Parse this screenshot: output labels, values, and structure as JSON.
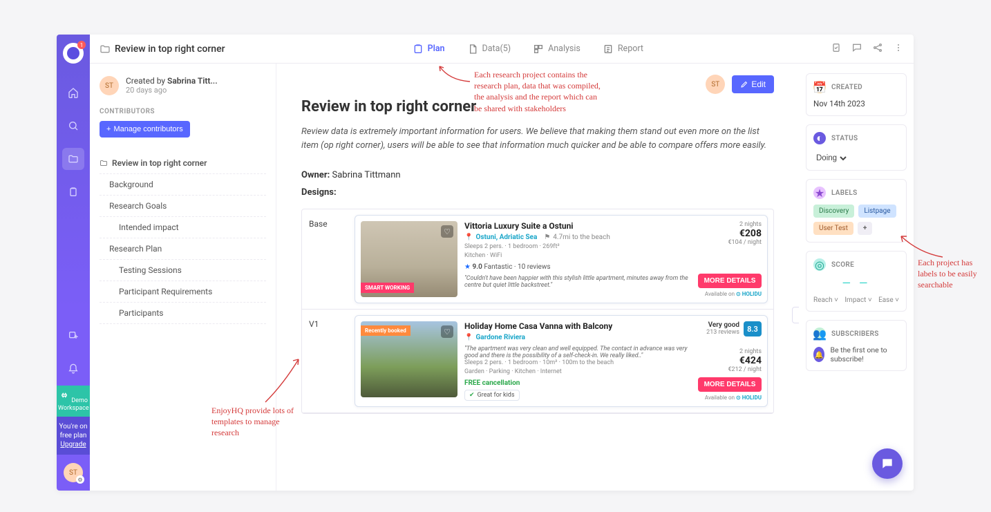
{
  "rail": {
    "logo_badge": "1",
    "demo_line1": "Demo",
    "demo_line2": "Workspace",
    "upgrade_line1": "You're on",
    "upgrade_line2": "free plan",
    "upgrade_link": "Upgrade",
    "avatar_initials": "ST"
  },
  "topbar": {
    "title": "Review in top right corner",
    "tabs": {
      "plan": "Plan",
      "data": "Data(5)",
      "analysis": "Analysis",
      "report": "Report"
    }
  },
  "meta": {
    "created_by_prefix": "Created by ",
    "created_by_name": "Sabrina Titt...",
    "created_ago": "20 days ago",
    "creator_initials": "ST",
    "contributors_head": "CONTRIBUTORS",
    "manage_btn": "Manage contributors"
  },
  "outline": {
    "root": "Review in top right corner",
    "items": [
      {
        "label": "Background",
        "lvl": 1
      },
      {
        "label": "Research Goals",
        "lvl": 1
      },
      {
        "label": "Intended impact",
        "lvl": 2
      },
      {
        "label": "Research Plan",
        "lvl": 1
      },
      {
        "label": "Testing Sessions",
        "lvl": 2
      },
      {
        "label": "Participant Requirements",
        "lvl": 2
      },
      {
        "label": "Participants",
        "lvl": 2
      }
    ]
  },
  "content": {
    "owner_initials": "ST",
    "edit_label": "Edit",
    "h1": "Review in top right corner",
    "intro": "Review data is extremely important information for users. We believe that making them stand out even more on the list item (op right corner), users will be able to see that information much quicker and be able to compare offers more easily.",
    "owner_label": "Owner:",
    "owner_value": "Sabrina Tittmann",
    "designs_label": "Designs:",
    "rows": [
      {
        "variant": "Base",
        "listing": {
          "img_tag": "SMART WORKING",
          "title": "Vittoria Luxury Suite a Ostuni",
          "loc1": "Ostuni, Adriatic Sea",
          "loc2": "4.7mi to the beach",
          "specs1": "Sleeps 2 pers. · 1 bedroom · 269ft²",
          "specs2": "Kitchen · WiFi",
          "rating_score": "9.0",
          "rating_label": "Fantastic · 10 reviews",
          "quote": "\"Couldn't have been happier with this stylish little apartment, minutes away from the centre but quiet little backstreet.\"",
          "nights": "2 nights",
          "price": "€208",
          "per_night": "€104 / night",
          "more": "MORE DETAILS",
          "avail": "Available on",
          "avail_brand": "HOLIDU"
        }
      },
      {
        "variant": "V1",
        "listing": {
          "img_tag": "Recently booked",
          "title": "Holiday Home Casa Vanna with Balcony",
          "loc1": "Gardone Riviera",
          "score_badge": "8.3",
          "vg": "Very good",
          "reviews": "213  reviews",
          "quote": "\"The apartment was very clean and well equipped. The contact in advance was very good and there is the possibility of a self-check-in. We really liked..\"",
          "specs1": "Sleeps 2 pers. · 1 bedroom · 10m² · 100m to the beach",
          "specs2": "Garden · Parking · Kitchen · Internet",
          "free_cancel": "FREE cancellation",
          "kids": "Great for kids",
          "nights": "2 nights",
          "price": "€424",
          "per_night": "€212 / night",
          "more": "MORE DETAILS",
          "avail": "Available on",
          "avail_brand": "HOLIDU"
        }
      }
    ]
  },
  "side": {
    "created_head": "CREATED",
    "created_val": "Nov 14th 2023",
    "status_head": "STATUS",
    "status_val": "Doing",
    "labels_head": "LABELS",
    "labels": [
      "Discovery",
      "Listpage",
      "User Test"
    ],
    "add_label": "+",
    "score_head": "SCORE",
    "score_reach": "Reach",
    "score_impact": "Impact",
    "score_ease": "Ease",
    "subs_head": "SUBSCRIBERS",
    "subs_empty": "Be the first one to subscribe!"
  },
  "annotations": {
    "top": "Each research project contains the research plan, data that was compiled, the analysis and the report which can be shared with stakeholders",
    "left": "EnjoyHQ provide lots of templates to manage research",
    "right": "Each project has labels to be easily searchable"
  }
}
